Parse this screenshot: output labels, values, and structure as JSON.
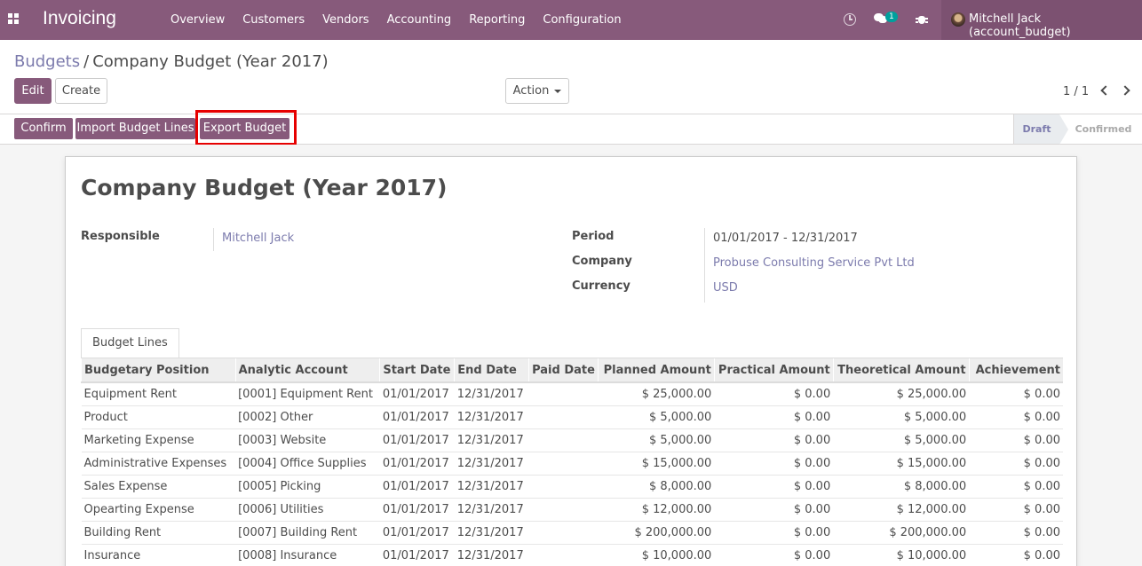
{
  "navbar": {
    "brand": "Invoicing",
    "menu": [
      "Overview",
      "Customers",
      "Vendors",
      "Accounting",
      "Reporting",
      "Configuration"
    ],
    "message_count": "1",
    "user": "Mitchell Jack (account_budget)"
  },
  "breadcrumb": {
    "parent": "Budgets",
    "separator": "/",
    "current": "Company Budget (Year 2017)"
  },
  "buttons": {
    "edit": "Edit",
    "create": "Create",
    "action": "Action"
  },
  "pager": "1 / 1",
  "statusbar": {
    "confirm": "Confirm",
    "import_lines": "Import Budget Lines",
    "export": "Export Budget",
    "stages": [
      "Draft",
      "Confirmed"
    ],
    "current_stage": "Draft"
  },
  "form": {
    "title": "Company Budget (Year 2017)",
    "responsible_label": "Responsible",
    "responsible": "Mitchell Jack",
    "period_label": "Period",
    "period": "01/01/2017 - 12/31/2017",
    "company_label": "Company",
    "company": "Probuse Consulting Service Pvt Ltd",
    "currency_label": "Currency",
    "currency": "USD"
  },
  "tab": "Budget Lines",
  "table": {
    "columns": [
      "Budgetary Position",
      "Analytic Account",
      "Start Date",
      "End Date",
      "Paid Date",
      "Planned Amount",
      "Practical Amount",
      "Theoretical Amount",
      "Achievement"
    ],
    "rows": [
      [
        "Equipment Rent",
        "[0001] Equipment Rent",
        "01/01/2017",
        "12/31/2017",
        "",
        "$ 25,000.00",
        "$ 0.00",
        "$ 25,000.00",
        "$ 0.00"
      ],
      [
        "Product",
        "[0002] Other",
        "01/01/2017",
        "12/31/2017",
        "",
        "$ 5,000.00",
        "$ 0.00",
        "$ 5,000.00",
        "$ 0.00"
      ],
      [
        "Marketing Expense",
        "[0003] Website",
        "01/01/2017",
        "12/31/2017",
        "",
        "$ 5,000.00",
        "$ 0.00",
        "$ 5,000.00",
        "$ 0.00"
      ],
      [
        "Administrative Expenses",
        "[0004] Office Supplies",
        "01/01/2017",
        "12/31/2017",
        "",
        "$ 15,000.00",
        "$ 0.00",
        "$ 15,000.00",
        "$ 0.00"
      ],
      [
        "Sales Expense",
        "[0005] Picking",
        "01/01/2017",
        "12/31/2017",
        "",
        "$ 8,000.00",
        "$ 0.00",
        "$ 8,000.00",
        "$ 0.00"
      ],
      [
        "Opearting Expense",
        "[0006] Utilities",
        "01/01/2017",
        "12/31/2017",
        "",
        "$ 12,000.00",
        "$ 0.00",
        "$ 12,000.00",
        "$ 0.00"
      ],
      [
        "Building Rent",
        "[0007] Building Rent",
        "01/01/2017",
        "12/31/2017",
        "",
        "$ 200,000.00",
        "$ 0.00",
        "$ 200,000.00",
        "$ 0.00"
      ],
      [
        "Insurance",
        "[0008] Insurance",
        "01/01/2017",
        "12/31/2017",
        "",
        "$ 10,000.00",
        "$ 0.00",
        "$ 10,000.00",
        "$ 0.00"
      ]
    ]
  },
  "colors": {
    "brand": "#875a7b",
    "link": "#7c7bad",
    "highlight": "#e60000"
  }
}
